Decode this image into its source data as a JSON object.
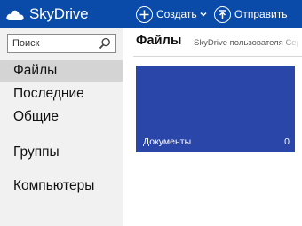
{
  "app": {
    "brand": "SkyDrive",
    "brand_icon": "cloud-icon"
  },
  "toolbar": {
    "create_label": "Создать",
    "create_icon": "plus-circle-icon",
    "send_label": "Отправить",
    "send_icon": "upload-icon"
  },
  "sidebar": {
    "search_placeholder": "Поиск",
    "items": [
      {
        "label": "Файлы",
        "active": true
      },
      {
        "label": "Последние",
        "active": false
      },
      {
        "label": "Общие",
        "active": false
      },
      {
        "label": "Группы",
        "active": false
      },
      {
        "label": "Компьютеры",
        "active": false
      }
    ]
  },
  "main": {
    "title": "Файлы",
    "subtitle": "SkyDrive пользователя Сергея",
    "folders": [
      {
        "name": "Документы",
        "count": "0"
      }
    ]
  },
  "colors": {
    "topbar": "#0a4aa8",
    "tile": "#2946a8",
    "sidebar": "#f1f1f1",
    "active_item": "#d4d4d4"
  }
}
